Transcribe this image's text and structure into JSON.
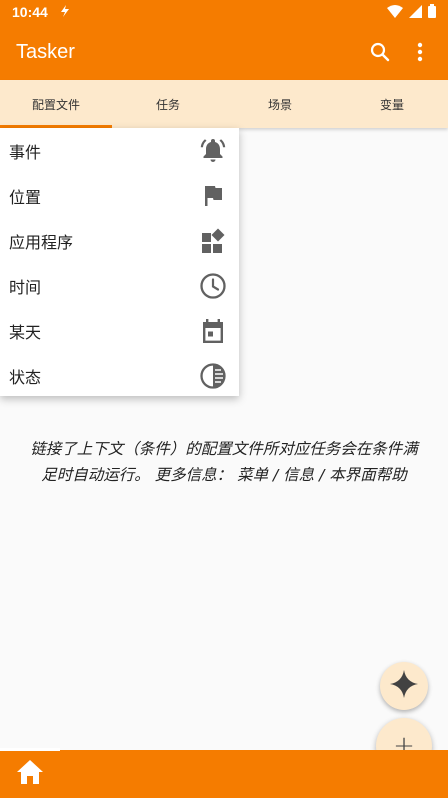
{
  "status_bar": {
    "time": "10:44"
  },
  "app_bar": {
    "title": "Tasker"
  },
  "tabs": [
    {
      "label": "配置文件",
      "active": true
    },
    {
      "label": "任务",
      "active": false
    },
    {
      "label": "场景",
      "active": false
    },
    {
      "label": "变量",
      "active": false
    }
  ],
  "menu": {
    "items": [
      {
        "label": "事件",
        "icon": "bell-alert-icon"
      },
      {
        "label": "位置",
        "icon": "flag-icon"
      },
      {
        "label": "应用程序",
        "icon": "widgets-icon"
      },
      {
        "label": "时间",
        "icon": "clock-icon"
      },
      {
        "label": "某天",
        "icon": "calendar-icon"
      },
      {
        "label": "状态",
        "icon": "contrast-icon"
      }
    ]
  },
  "help": {
    "line1": "链接了上下文（条件）的配置文件所对应任务会在条件满",
    "line2": "足时自动运行。 更多信息： 菜单 / 信息 / 本界面帮助"
  },
  "fab": {
    "add_label": "+"
  },
  "colors": {
    "primary": "#f57c00",
    "tab_bg": "#fde9cc",
    "background": "#fafafa"
  }
}
